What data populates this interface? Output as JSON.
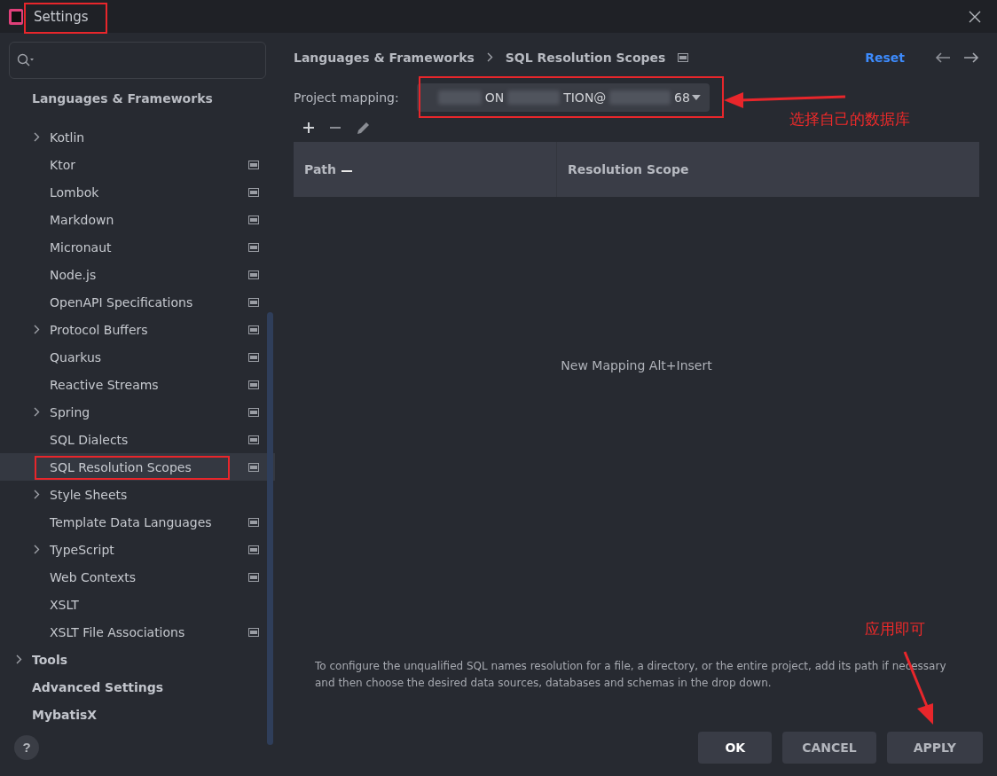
{
  "window": {
    "title": "Settings"
  },
  "sidebar": {
    "section": "Languages & Frameworks",
    "items": [
      {
        "label": "Kotlin",
        "expandable": true,
        "project_level": false,
        "selected": false
      },
      {
        "label": "Ktor",
        "expandable": false,
        "project_level": true,
        "selected": false
      },
      {
        "label": "Lombok",
        "expandable": false,
        "project_level": true,
        "selected": false
      },
      {
        "label": "Markdown",
        "expandable": false,
        "project_level": true,
        "selected": false
      },
      {
        "label": "Micronaut",
        "expandable": false,
        "project_level": true,
        "selected": false
      },
      {
        "label": "Node.js",
        "expandable": false,
        "project_level": true,
        "selected": false
      },
      {
        "label": "OpenAPI Specifications",
        "expandable": false,
        "project_level": true,
        "selected": false
      },
      {
        "label": "Protocol Buffers",
        "expandable": true,
        "project_level": true,
        "selected": false
      },
      {
        "label": "Quarkus",
        "expandable": false,
        "project_level": true,
        "selected": false
      },
      {
        "label": "Reactive Streams",
        "expandable": false,
        "project_level": true,
        "selected": false
      },
      {
        "label": "Spring",
        "expandable": true,
        "project_level": true,
        "selected": false
      },
      {
        "label": "SQL Dialects",
        "expandable": false,
        "project_level": true,
        "selected": false
      },
      {
        "label": "SQL Resolution Scopes",
        "expandable": false,
        "project_level": true,
        "selected": true
      },
      {
        "label": "Style Sheets",
        "expandable": true,
        "project_level": false,
        "selected": false
      },
      {
        "label": "Template Data Languages",
        "expandable": false,
        "project_level": true,
        "selected": false
      },
      {
        "label": "TypeScript",
        "expandable": true,
        "project_level": true,
        "selected": false
      },
      {
        "label": "Web Contexts",
        "expandable": false,
        "project_level": true,
        "selected": false
      },
      {
        "label": "XSLT",
        "expandable": false,
        "project_level": false,
        "selected": false
      },
      {
        "label": "XSLT File Associations",
        "expandable": false,
        "project_level": true,
        "selected": false
      }
    ],
    "top_items": [
      {
        "label": "Tools",
        "expandable": true
      },
      {
        "label": "Advanced Settings",
        "expandable": false
      },
      {
        "label": "MybatisX",
        "expandable": false
      }
    ]
  },
  "breadcrumb": [
    "Languages & Frameworks",
    "SQL Resolution Scopes"
  ],
  "reset": "Reset",
  "project_mapping": {
    "label": "Project mapping:",
    "value_fragments": [
      "ON",
      "TION@",
      "68"
    ]
  },
  "table": {
    "columns": [
      "Path",
      "Resolution Scope"
    ],
    "empty_text": "New Mapping Alt+Insert"
  },
  "description": "To configure the unqualified SQL names resolution for a file, a directory, or the entire project, add its path if necessary and then choose the desired data sources, databases and schemas in the drop down.",
  "buttons": [
    {
      "label": "OK",
      "default": true
    },
    {
      "label": "CANCEL",
      "default": false
    },
    {
      "label": "APPLY",
      "default": false
    }
  ],
  "help": "?",
  "annotations": [
    "选择自己的数据库",
    "应用即可"
  ]
}
